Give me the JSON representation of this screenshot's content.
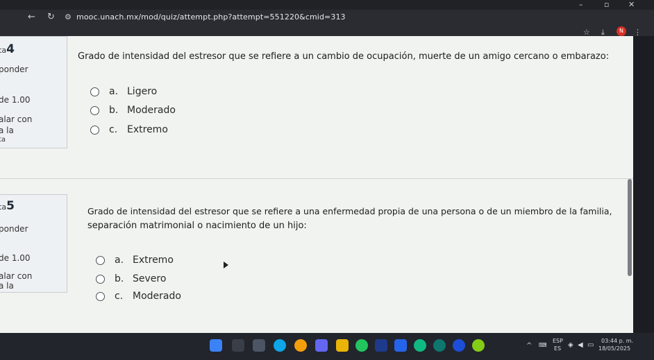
{
  "browser": {
    "url": "mooc.unach.mx/mod/quiz/attempt.php?attempt=551220&cmid=313",
    "minimize": "–",
    "restore": "▫",
    "close": "✕"
  },
  "question4": {
    "number_prefix": "ta",
    "number": "4",
    "info_lines": [
      "ponder",
      "de 1.00",
      "alar con",
      "a la",
      "ta"
    ],
    "text": "Grado de intensidad del estresor que se refiere a un cambio de ocupación, muerte de un amigo cercano o embarazo:",
    "options": [
      {
        "letter": "a.",
        "text": "Ligero"
      },
      {
        "letter": "b.",
        "text": "Moderado"
      },
      {
        "letter": "c.",
        "text": "Extremo"
      }
    ]
  },
  "question5": {
    "number_prefix": "ta",
    "number": "5",
    "info_lines": [
      "ponder",
      "de 1.00",
      "alar con",
      "a la"
    ],
    "text_line1": "Grado de intensidad del estresor que se refiere a una enfermedad propia de una persona o de un miembro de la familia,",
    "text_line2": "separación matrimonial o nacimiento de un hijo:",
    "options": [
      {
        "letter": "a.",
        "text": "Extremo"
      },
      {
        "letter": "b.",
        "text": "Severo"
      },
      {
        "letter": "c.",
        "text": "Moderado"
      }
    ]
  },
  "taskbar": {
    "lang_top": "ESP",
    "lang_bottom": "ES",
    "time": "03:44 p. m.",
    "date": "18/05/2025"
  }
}
